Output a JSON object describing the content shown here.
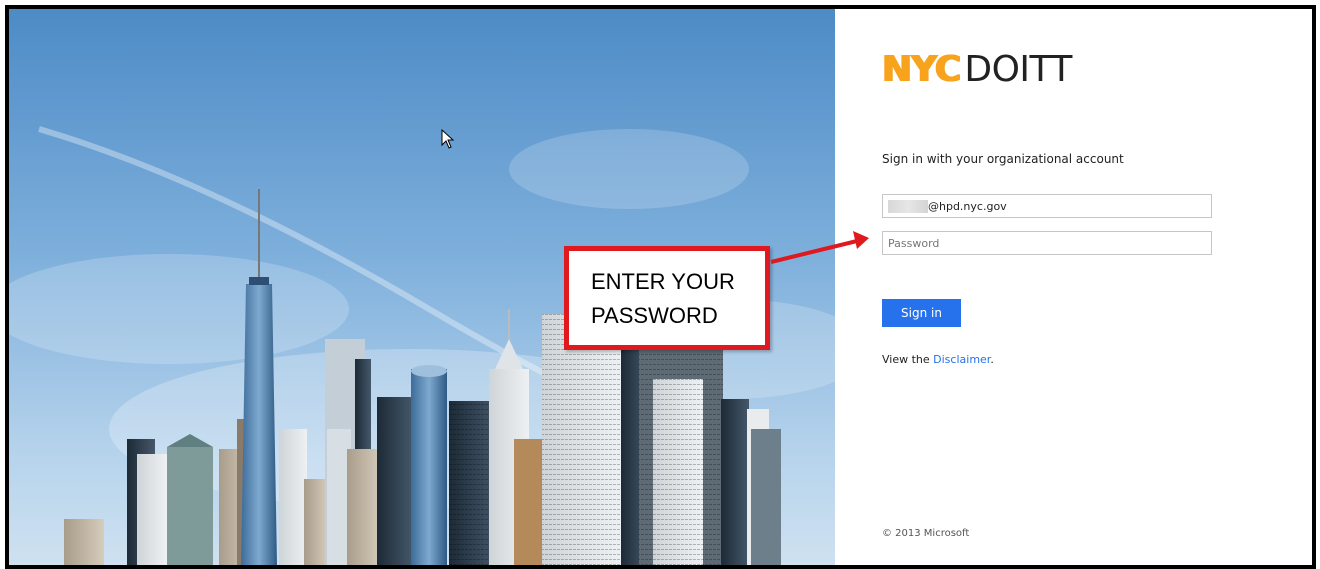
{
  "logo": {
    "brand": "NYC",
    "name": "DOITT",
    "brand_color": "#f7a31c"
  },
  "signin": {
    "heading": "Sign in with your organizational account",
    "username_value": "@hpd.nyc.gov",
    "password_placeholder": "Password",
    "button_label": "Sign in",
    "accent_color": "#2672ec"
  },
  "disclaimer": {
    "prefix": "View the ",
    "link_text": "Disclaimer",
    "suffix": "."
  },
  "footer": {
    "copyright": "© 2013 Microsoft"
  },
  "callout": {
    "line1": "ENTER YOUR",
    "line2": "PASSWORD",
    "border_color": "#e0191e"
  },
  "icons": {
    "cursor": "mouse-pointer-icon",
    "arrow": "callout-arrow-icon"
  }
}
